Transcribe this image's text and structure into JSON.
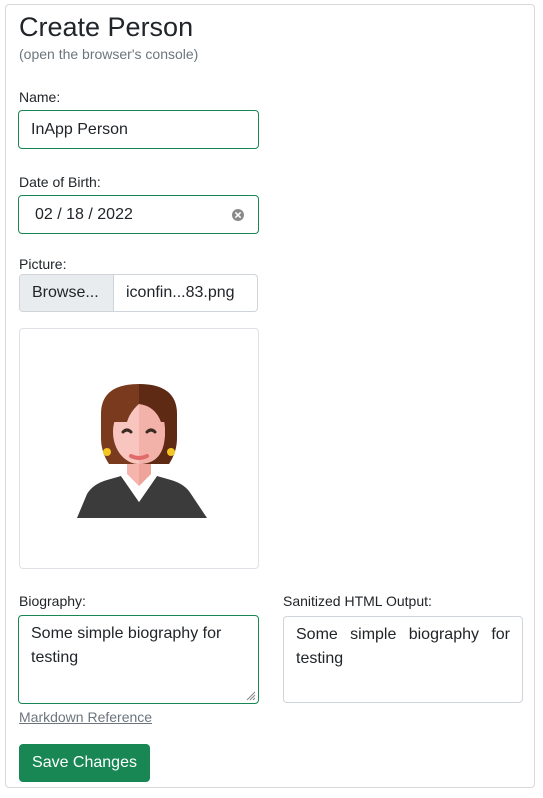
{
  "page": {
    "title": "Create Person",
    "subtitle": "(open the browser's console)"
  },
  "form": {
    "name": {
      "label": "Name:",
      "value": "InApp Person"
    },
    "dob": {
      "label": "Date of Birth:",
      "value": "02 / 18 / 2022",
      "clear_icon": "clear-circle-icon"
    },
    "picture": {
      "label": "Picture:",
      "browse_label": "Browse...",
      "file_name": "iconfin...83.png",
      "image_icon": "woman-avatar"
    },
    "biography": {
      "label": "Biography:",
      "value": "Some simple biography for testing"
    },
    "sanitized": {
      "label": "Sanitized HTML Output:",
      "value": "Some simple biography for testing"
    },
    "markdown_link": "Markdown Reference",
    "save_label": "Save Changes"
  },
  "colors": {
    "accent_green": "#198754",
    "border_gray": "#ced4da",
    "muted_text": "#6c757d"
  }
}
